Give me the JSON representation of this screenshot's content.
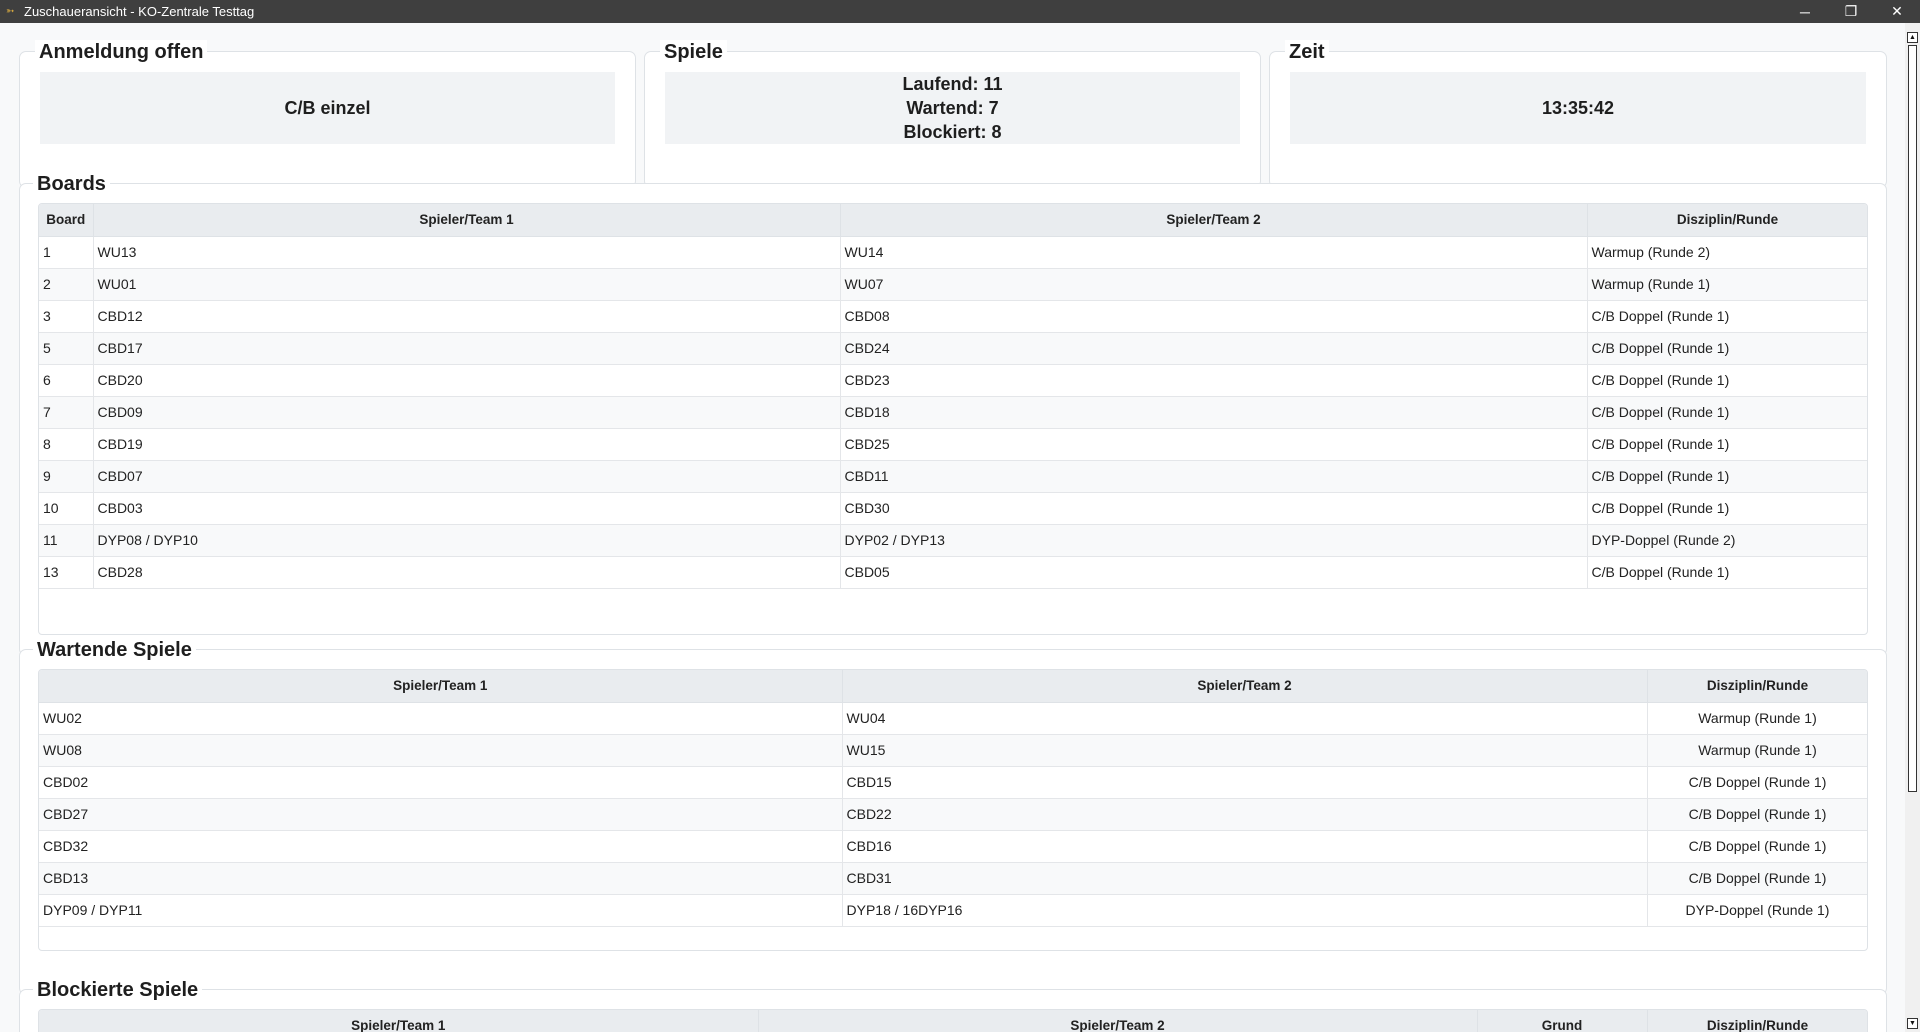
{
  "window": {
    "title": "Zuschaueransicht - KO-Zentrale Testtag",
    "minimize": "─",
    "maximize": "❐",
    "close": "✕"
  },
  "summary": {
    "registration": {
      "title": "Anmeldung offen",
      "value": "C/B einzel"
    },
    "games": {
      "title": "Spiele",
      "running": "Laufend: 11",
      "waiting": "Wartend: 7",
      "blocked": "Blockiert: 8"
    },
    "time": {
      "title": "Zeit",
      "value": "13:35:42"
    }
  },
  "boards": {
    "title": "Boards",
    "headers": [
      "Board",
      "Spieler/Team 1",
      "Spieler/Team 2",
      "Disziplin/Runde"
    ],
    "rows": [
      [
        "1",
        "WU13",
        "WU14",
        "Warmup (Runde 2)"
      ],
      [
        "2",
        "WU01",
        "WU07",
        "Warmup (Runde 1)"
      ],
      [
        "3",
        "CBD12",
        "CBD08",
        "C/B Doppel (Runde 1)"
      ],
      [
        "5",
        "CBD17",
        "CBD24",
        "C/B Doppel (Runde 1)"
      ],
      [
        "6",
        "CBD20",
        "CBD23",
        "C/B Doppel (Runde 1)"
      ],
      [
        "7",
        "CBD09",
        "CBD18",
        "C/B Doppel (Runde 1)"
      ],
      [
        "8",
        "CBD19",
        "CBD25",
        "C/B Doppel (Runde 1)"
      ],
      [
        "9",
        "CBD07",
        "CBD11",
        "C/B Doppel (Runde 1)"
      ],
      [
        "10",
        "CBD03",
        "CBD30",
        "C/B Doppel (Runde 1)"
      ],
      [
        "11",
        "DYP08 / DYP10",
        "DYP02 / DYP13",
        "DYP-Doppel (Runde 2)"
      ],
      [
        "13",
        "CBD28",
        "CBD05",
        "C/B Doppel (Runde 1)"
      ]
    ]
  },
  "waiting": {
    "title": "Wartende Spiele",
    "headers": [
      "Spieler/Team 1",
      "Spieler/Team 2",
      "Disziplin/Runde"
    ],
    "rows": [
      [
        "WU02",
        "WU04",
        "Warmup (Runde 1)"
      ],
      [
        "WU08",
        "WU15",
        "Warmup (Runde 1)"
      ],
      [
        "CBD02",
        "CBD15",
        "C/B Doppel (Runde 1)"
      ],
      [
        "CBD27",
        "CBD22",
        "C/B Doppel (Runde 1)"
      ],
      [
        "CBD32",
        "CBD16",
        "C/B Doppel (Runde 1)"
      ],
      [
        "CBD13",
        "CBD31",
        "C/B Doppel (Runde 1)"
      ],
      [
        "DYP09 / DYP11",
        "DYP18 / 16DYP16",
        "DYP-Doppel (Runde 1)"
      ]
    ]
  },
  "blocked": {
    "title": "Blockierte Spiele",
    "headers": [
      "Spieler/Team 1",
      "Spieler/Team 2",
      "Grund",
      "Disziplin/Runde"
    ]
  }
}
